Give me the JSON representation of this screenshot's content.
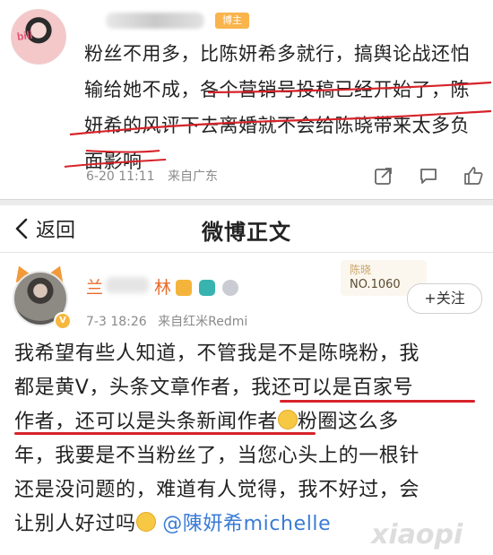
{
  "top_comment": {
    "badge": "博主",
    "avatar_text": "bili",
    "lines": [
      "粉丝不用多，比陈妍希多就行，搞舆论战还怕",
      "输给她不成，各个营销号投稿已经开始了，陈",
      "妍希的风评下去离婚就不会给陈晓带来太多负",
      "面影响"
    ],
    "time": "6-20 11:11",
    "location": "来自广东"
  },
  "nav": {
    "back_label": "返回",
    "title": "微博正文"
  },
  "post": {
    "name_prefix": "兰",
    "name_suffix": "林",
    "time": "7-3 18:26",
    "source": "来自红米Redmi",
    "fan_card_name": "陈晓",
    "fan_card_no": "NO.1060",
    "follow_label": "+关注",
    "lines": [
      "我希望有些人知道，不管我是不是陈晓粉，我",
      "都是黄V，头条文章作者，我还可以是百家号",
      "作者，还可以是头条新闻作者",
      "粉圈这么多",
      "年，我要是不当粉丝了，当您心头上的一根针",
      "还是没问题的，难道有人觉得，我不好过，会",
      "让别人好过吗",
      "@陳妍希michelle"
    ]
  },
  "watermark": {
    "text": "xiaopi"
  },
  "colors": {
    "underline_red": "#d6232a",
    "mention_blue": "#3a7bd5",
    "username_orange": "#e86b2a",
    "blogger_badge": "#f9b44c"
  }
}
